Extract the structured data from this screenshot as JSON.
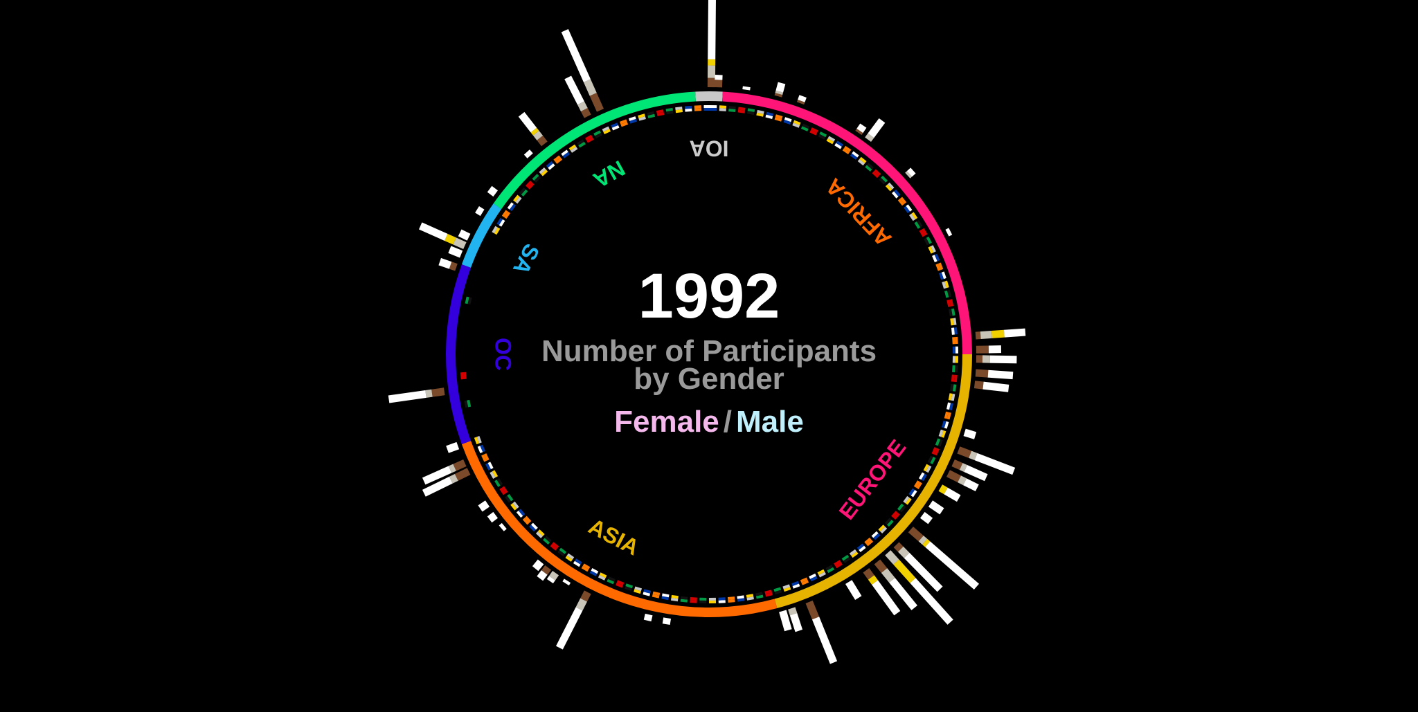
{
  "chart_data": {
    "type": "radial-bar",
    "title": "Number of Participants",
    "subtitle": "by Gender",
    "year": "1992",
    "legend": {
      "female": "Female",
      "separator": "/",
      "male": "Male"
    },
    "legend_colors": {
      "female": "#f5b8ec",
      "male": "#bff0fb"
    },
    "regions": [
      {
        "name": "IOA",
        "color": "#c8c8c8",
        "label_color": "#cccccc",
        "start_deg": -3,
        "end_deg": 3
      },
      {
        "name": "AFRICA",
        "color": "#ff1477",
        "label_color": "#ff6a00",
        "start_deg": 3,
        "end_deg": 90
      },
      {
        "name": "EUROPE",
        "color": "#e6b400",
        "label_color": "#ff1477",
        "start_deg": 90,
        "end_deg": 165
      },
      {
        "name": "ASIA",
        "color": "#ff6a00",
        "label_color": "#e6b400",
        "start_deg": 165,
        "end_deg": 250
      },
      {
        "name": "OC",
        "color": "#3300dd",
        "label_color": "#3300dd",
        "start_deg": 250,
        "end_deg": 290
      },
      {
        "name": "SA",
        "color": "#22b4f0",
        "label_color": "#22b4f0",
        "start_deg": 290,
        "end_deg": 305
      },
      {
        "name": "NA",
        "color": "#00e676",
        "label_color": "#00e676",
        "start_deg": 305,
        "end_deg": 357
      }
    ],
    "bar_colors": {
      "participants": "#ffffff",
      "bronze": "#7a4a2a",
      "silver": "#c8c4b8",
      "gold": "#f2d100"
    },
    "bars": [
      {
        "angle": 0.5,
        "participants": 145,
        "gold": 10,
        "silver": 20,
        "bronze": 15
      },
      {
        "angle": 2.0,
        "participants": 20,
        "gold": 0,
        "silver": 0,
        "bronze": 12
      },
      {
        "angle": 8.0,
        "participants": 5,
        "gold": 0,
        "silver": 0,
        "bronze": 0
      },
      {
        "angle": 15.0,
        "participants": 22,
        "gold": 0,
        "silver": 4,
        "bronze": 4
      },
      {
        "angle": 20.0,
        "participants": 12,
        "gold": 0,
        "silver": 0,
        "bronze": 4
      },
      {
        "angle": 34.0,
        "participants": 14,
        "gold": 0,
        "silver": 0,
        "bronze": 4
      },
      {
        "angle": 36.5,
        "participants": 38,
        "gold": 0,
        "silver": 8,
        "bronze": 0
      },
      {
        "angle": 48.0,
        "participants": 12,
        "gold": 0,
        "silver": 4,
        "bronze": 0
      },
      {
        "angle": 63.0,
        "participants": 6,
        "gold": 0,
        "silver": 0,
        "bronze": 0
      },
      {
        "angle": 86.0,
        "participants": 80,
        "gold": 20,
        "silver": 18,
        "bronze": 8
      },
      {
        "angle": 89.0,
        "participants": 40,
        "gold": 0,
        "silver": 0,
        "bronze": 20
      },
      {
        "angle": 91.0,
        "participants": 65,
        "gold": 0,
        "silver": 12,
        "bronze": 10
      },
      {
        "angle": 94.0,
        "participants": 60,
        "gold": 0,
        "silver": 0,
        "bronze": 20
      },
      {
        "angle": 96.5,
        "participants": 55,
        "gold": 0,
        "silver": 0,
        "bronze": 14
      },
      {
        "angle": 107.0,
        "participants": 18,
        "gold": 0,
        "silver": 0,
        "bronze": 0
      },
      {
        "angle": 111.0,
        "participants": 95,
        "gold": 0,
        "silver": 10,
        "bronze": 20
      },
      {
        "angle": 114.0,
        "participants": 58,
        "gold": 0,
        "silver": 8,
        "bronze": 14
      },
      {
        "angle": 116.5,
        "participants": 52,
        "gold": 0,
        "silver": 10,
        "bronze": 20
      },
      {
        "angle": 120.0,
        "participants": 34,
        "gold": 10,
        "silver": 0,
        "bronze": 0
      },
      {
        "angle": 124.0,
        "participants": 22,
        "gold": 0,
        "silver": 0,
        "bronze": 0
      },
      {
        "angle": 127.0,
        "participants": 16,
        "gold": 0,
        "silver": 0,
        "bronze": 0
      },
      {
        "angle": 131.0,
        "participants": 140,
        "gold": 6,
        "silver": 8,
        "bronze": 22
      },
      {
        "angle": 135.5,
        "participants": 100,
        "gold": 0,
        "silver": 14,
        "bronze": 10
      },
      {
        "angle": 138.0,
        "participants": 150,
        "gold": 40,
        "silver": 20,
        "bronze": 0
      },
      {
        "angle": 141.0,
        "participants": 95,
        "gold": 0,
        "silver": 20,
        "bronze": 18
      },
      {
        "angle": 144.0,
        "participants": 85,
        "gold": 10,
        "silver": 0,
        "bronze": 14
      },
      {
        "angle": 148.5,
        "participants": 30,
        "gold": 0,
        "silver": 0,
        "bronze": 0
      },
      {
        "angle": 158.0,
        "participants": 105,
        "gold": 0,
        "silver": 0,
        "bronze": 28
      },
      {
        "angle": 162.0,
        "participants": 38,
        "gold": 0,
        "silver": 10,
        "bronze": 0
      },
      {
        "angle": 164.0,
        "participants": 32,
        "gold": 0,
        "silver": 0,
        "bronze": 0
      },
      {
        "angle": 189.0,
        "participants": 10,
        "gold": 0,
        "silver": 0,
        "bronze": 0
      },
      {
        "angle": 193.0,
        "participants": 10,
        "gold": 0,
        "silver": 0,
        "bronze": 0
      },
      {
        "angle": 207.0,
        "participants": 100,
        "gold": 0,
        "silver": 16,
        "bronze": 14
      },
      {
        "angle": 212.0,
        "participants": 5,
        "gold": 0,
        "silver": 0,
        "bronze": 0
      },
      {
        "angle": 215.0,
        "participants": 16,
        "gold": 0,
        "silver": 10,
        "bronze": 0
      },
      {
        "angle": 217.0,
        "participants": 22,
        "gold": 0,
        "silver": 0,
        "bronze": 10
      },
      {
        "angle": 219.0,
        "participants": 14,
        "gold": 0,
        "silver": 0,
        "bronze": 0
      },
      {
        "angle": 230.0,
        "participants": 6,
        "gold": 0,
        "silver": 0,
        "bronze": 0
      },
      {
        "angle": 233.0,
        "participants": 12,
        "gold": 0,
        "silver": 0,
        "bronze": 0
      },
      {
        "angle": 236.0,
        "participants": 14,
        "gold": 0,
        "silver": 0,
        "bronze": 0
      },
      {
        "angle": 244.0,
        "participants": 80,
        "gold": 0,
        "silver": 10,
        "bronze": 22
      },
      {
        "angle": 246.0,
        "participants": 72,
        "gold": 0,
        "silver": 8,
        "bronze": 18
      },
      {
        "angle": 250.0,
        "participants": 18,
        "gold": 0,
        "silver": 0,
        "bronze": 0
      },
      {
        "angle": 262.0,
        "participants": 90,
        "gold": 0,
        "silver": 10,
        "bronze": 20
      },
      {
        "angle": 289.0,
        "participants": 28,
        "gold": 0,
        "silver": 0,
        "bronze": 10
      },
      {
        "angle": 294.0,
        "participants": 78,
        "gold": 15,
        "silver": 18,
        "bronze": 0
      },
      {
        "angle": 292.0,
        "participants": 20,
        "gold": 0,
        "silver": 0,
        "bronze": 0
      },
      {
        "angle": 296.0,
        "participants": 16,
        "gold": 0,
        "silver": 0,
        "bronze": 0
      },
      {
        "angle": 302.0,
        "participants": 10,
        "gold": 0,
        "silver": 0,
        "bronze": 0
      },
      {
        "angle": 307.0,
        "participants": 12,
        "gold": 0,
        "silver": 0,
        "bronze": 0
      },
      {
        "angle": 318.0,
        "participants": 8,
        "gold": 0,
        "silver": 0,
        "bronze": 0
      },
      {
        "angle": 322.0,
        "participants": 60,
        "gold": 6,
        "silver": 10,
        "bronze": 12
      },
      {
        "angle": 333.0,
        "participants": 70,
        "gold": 0,
        "silver": 12,
        "bronze": 12
      },
      {
        "angle": 336.0,
        "participants": 140,
        "gold": 0,
        "silver": 24,
        "bronze": 28
      }
    ]
  }
}
